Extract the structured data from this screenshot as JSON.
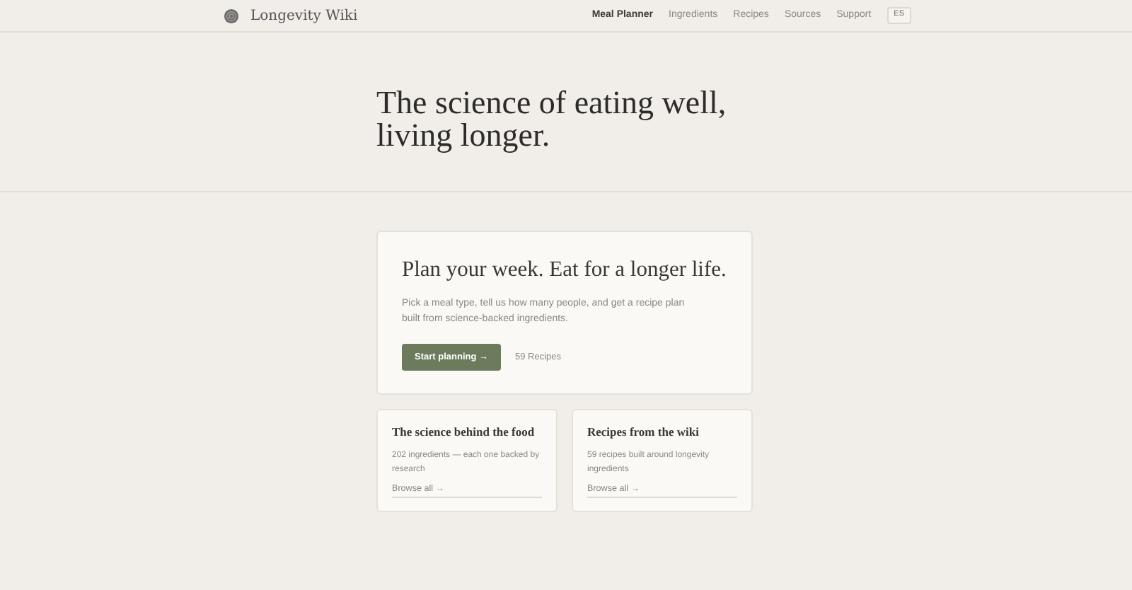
{
  "brand": {
    "name": "Longevity Wiki"
  },
  "nav": [
    {
      "label": "Meal Planner",
      "selected": true
    },
    {
      "label": "Ingredients",
      "selected": false
    },
    {
      "label": "Recipes",
      "selected": false
    },
    {
      "label": "Sources",
      "selected": false
    },
    {
      "label": "Support",
      "selected": false
    }
  ],
  "language": "ES",
  "hero": {
    "title": "The science of eating well, living longer."
  },
  "planner": {
    "title": "Plan your week. Eat for a longer life.",
    "text": "Pick a meal type, tell us how many people, and get a recipe plan built from science-backed ingredients.",
    "button": "Start planning →",
    "count": "59 Recipes"
  },
  "cards": [
    {
      "title": "The science behind the food",
      "text": "202 ingredients — each one backed by research",
      "link": "Browse all →"
    },
    {
      "title": "Recipes from the wiki",
      "text": "59 recipes built around longevity ingredients",
      "link": "Browse all →"
    }
  ]
}
